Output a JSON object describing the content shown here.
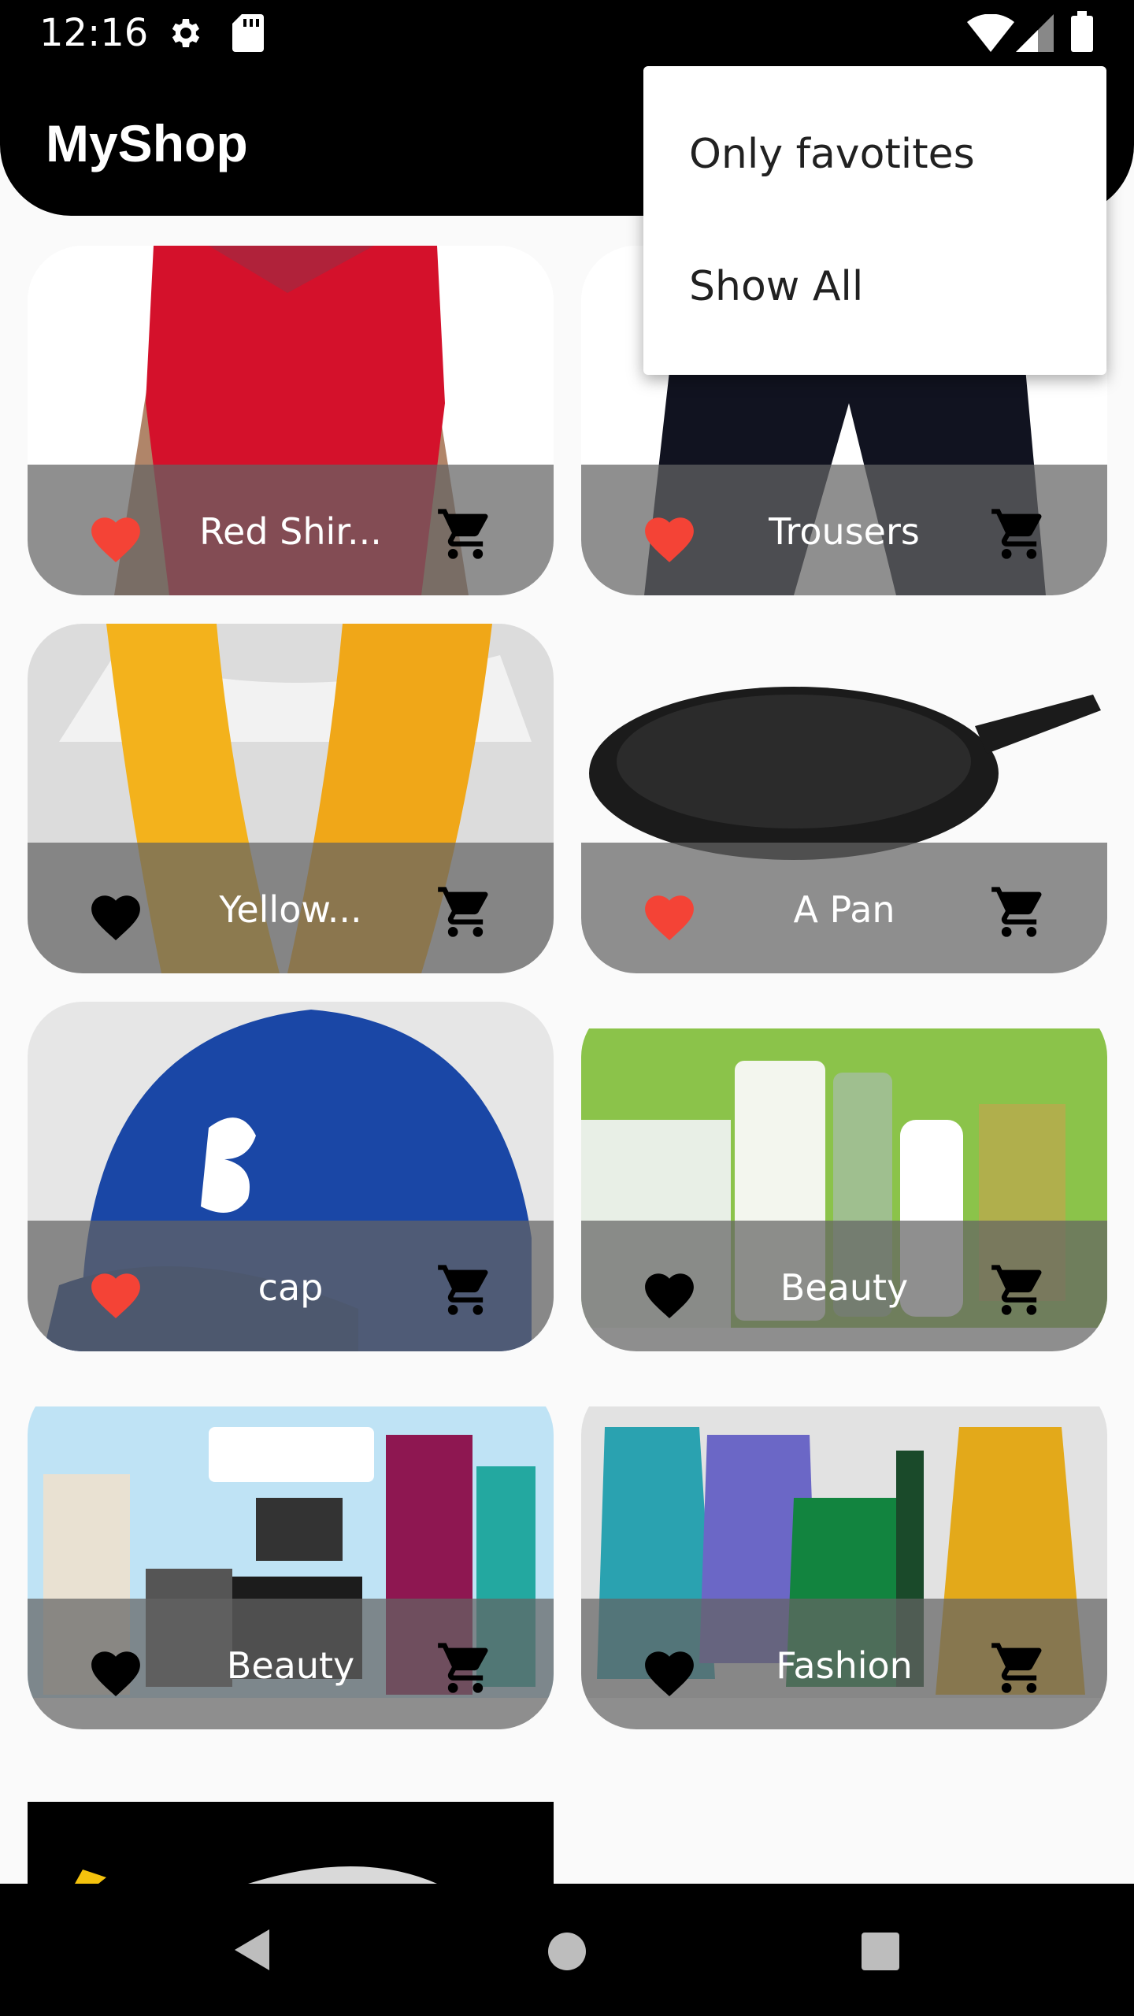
{
  "status_bar": {
    "time": "12:16",
    "icons": [
      "gear-icon",
      "sd-card-icon",
      "wifi-icon",
      "signal-icon",
      "battery-icon"
    ]
  },
  "app_bar": {
    "title": "MyShop"
  },
  "menu": {
    "items": [
      {
        "label": "Only favotites"
      },
      {
        "label": "Show All"
      }
    ]
  },
  "products": [
    {
      "title": "Red Shir...",
      "favorite": true,
      "image": "red-shirt"
    },
    {
      "title": "Trousers",
      "favorite": true,
      "image": "trousers"
    },
    {
      "title": "Yellow...",
      "favorite": false,
      "image": "yellow-scarf"
    },
    {
      "title": "A Pan",
      "favorite": true,
      "image": "pan"
    },
    {
      "title": "cap",
      "favorite": true,
      "image": "cap"
    },
    {
      "title": "Beauty",
      "favorite": false,
      "image": "beauty-products"
    },
    {
      "title": "Beauty",
      "favorite": false,
      "image": "electronics"
    },
    {
      "title": "Fashion",
      "favorite": false,
      "image": "fashion-clothes"
    }
  ],
  "colors": {
    "favorite": "#f44336",
    "not_favorite": "#000000",
    "app_bar": "#000000",
    "menu_text": "#212121"
  },
  "nav_bar": {
    "icons": [
      "back-icon",
      "home-icon",
      "recents-icon"
    ]
  }
}
